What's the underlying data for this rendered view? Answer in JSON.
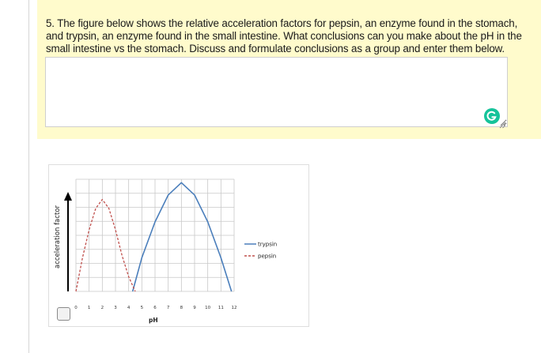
{
  "question": {
    "text": "5. The figure below shows the relative acceleration factors for pepsin, an enzyme found in the stomach, and trypsin, an enzyme found in the small intestine. What conclusions can you make about the pH in the small intestine vs the stomach. Discuss and formulate conclusions as a group and enter them below.",
    "answer_value": ""
  },
  "icons": {
    "grammarly": "grammarly-g-icon",
    "resize": "resize-handle-icon",
    "checkbox": "checkbox-unchecked-icon"
  },
  "colors": {
    "panel_background": "#fffbcc",
    "trypsin": "#4a7ebb",
    "pepsin": "#c0504d",
    "grammarly": "#15c39a"
  },
  "chart_data": {
    "type": "line",
    "title": "",
    "xlabel": "pH",
    "ylabel": "acceleration factor",
    "xlim": [
      0,
      12
    ],
    "ylim": [
      0,
      1
    ],
    "x_ticks": [
      "0",
      "1",
      "2",
      "3",
      "4",
      "5",
      "6",
      "7",
      "8",
      "9",
      "10",
      "11",
      "12"
    ],
    "grid": true,
    "legend_position": "right",
    "series": [
      {
        "name": "trypsin",
        "color": "#4a7ebb",
        "dash": "solid",
        "points": [
          [
            4.3,
            0
          ],
          [
            5,
            0.3
          ],
          [
            6,
            0.62
          ],
          [
            7,
            0.86
          ],
          [
            8,
            0.97
          ],
          [
            9,
            0.86
          ],
          [
            10,
            0.62
          ],
          [
            11,
            0.3
          ],
          [
            11.8,
            0
          ]
        ]
      },
      {
        "name": "pepsin",
        "color": "#c0504d",
        "dash": "dashed",
        "points": [
          [
            0,
            0
          ],
          [
            0.5,
            0.3
          ],
          [
            1,
            0.55
          ],
          [
            1.5,
            0.74
          ],
          [
            2,
            0.82
          ],
          [
            2.5,
            0.74
          ],
          [
            3,
            0.55
          ],
          [
            3.5,
            0.32
          ],
          [
            4,
            0.13
          ],
          [
            4.5,
            0
          ]
        ]
      }
    ]
  }
}
